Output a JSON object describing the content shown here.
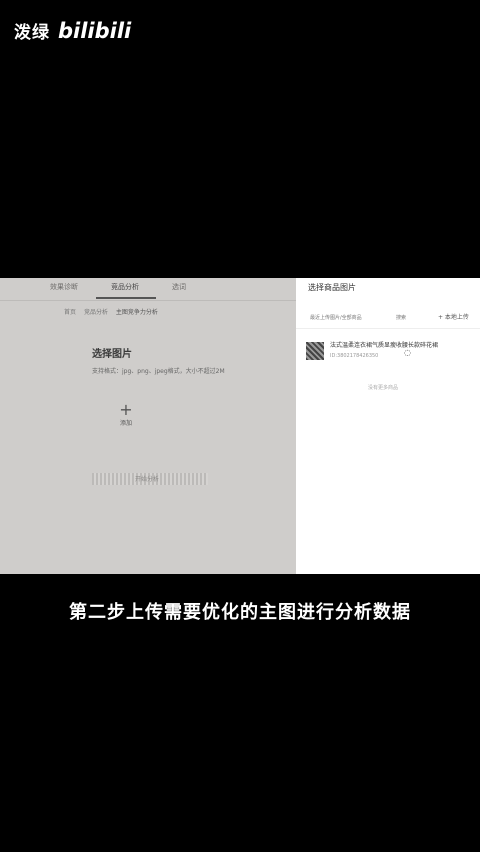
{
  "watermark": {
    "text": "泼绿",
    "logo": "bilibili"
  },
  "left_panel": {
    "tabs": [
      "效果诊断",
      "竞品分析",
      "选词"
    ],
    "breadcrumbs": [
      "首页",
      "竞品分析",
      "主图竞争力分析"
    ],
    "select_title": "选择图片",
    "select_desc": "支持格式：jpg、png、jpeg格式，大小不超过2M",
    "upload_plus": "+",
    "upload_label": "添加",
    "blur_label": "开始分析"
  },
  "right_panel": {
    "title": "选择商品图片",
    "filter_left": "最近上传图片/全部商品",
    "filter_mid": "搜索",
    "upload_label": "+ 本地上传",
    "item": {
      "name": "法式温柔连衣裙气质显瘦收腰长款碎花裙",
      "meta": "ID:3802178426350"
    },
    "more": "没有更多商品"
  },
  "caption": "第二步上传需要优化的主图进行分析数据"
}
